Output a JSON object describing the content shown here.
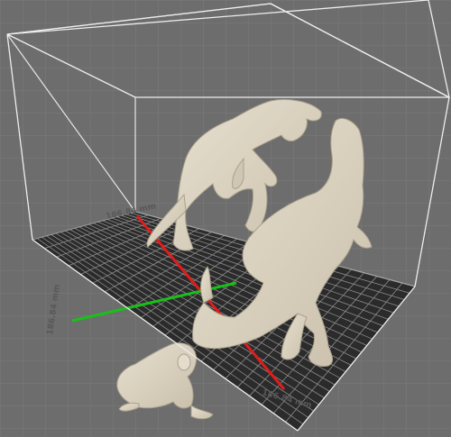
{
  "viewport": {
    "background": "#6d6d6d",
    "grid_color": "#7a7a7a",
    "bed_color": "#2b2b2b",
    "bed_line_color": "#8c8c8c",
    "build_volume_color": "#e6e6e6",
    "x_axis_color": "#e01c1c",
    "y_axis_color": "#19c019",
    "model_color": "#ddd5c4"
  },
  "dimensions": {
    "back_width": "186.84 mm",
    "depth": "186.84 mm",
    "front_width": "186.84 mm"
  },
  "models": [
    {
      "name": "t-rex-back"
    },
    {
      "name": "t-rex-front"
    },
    {
      "name": "frog"
    }
  ]
}
